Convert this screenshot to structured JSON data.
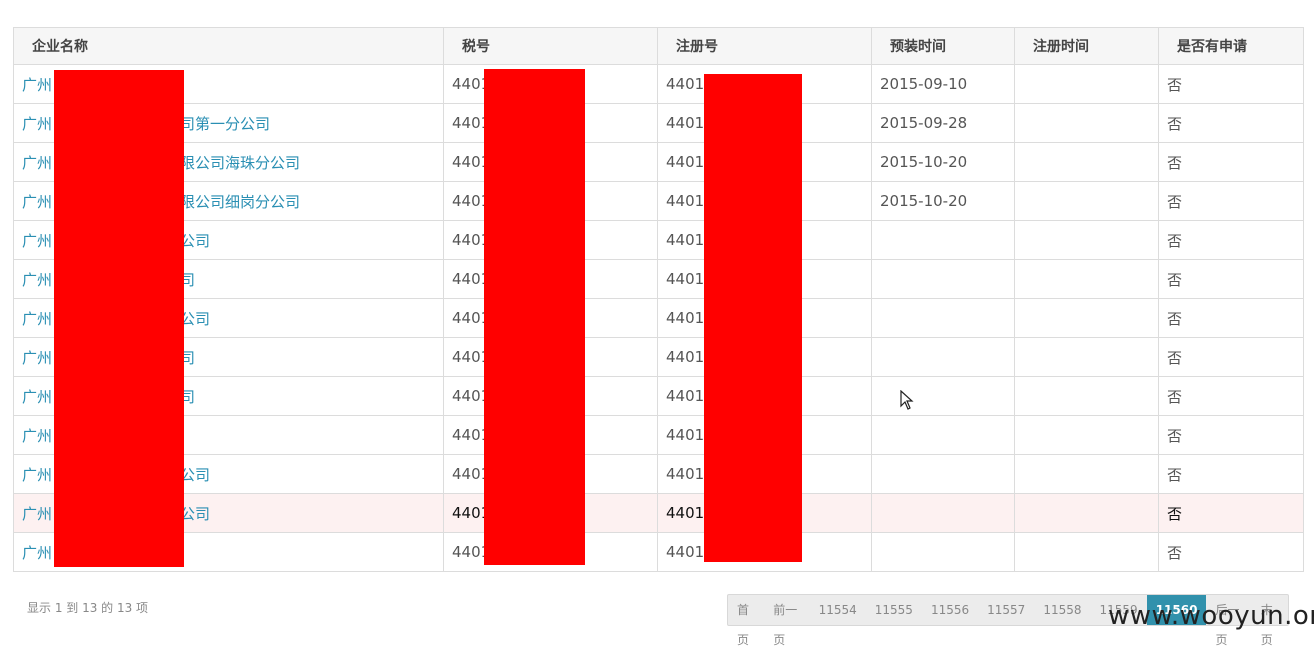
{
  "table": {
    "headers": [
      "企业名称",
      "税号",
      "注册号",
      "预装时间",
      "注册时间",
      "是否有申请"
    ],
    "rows": [
      {
        "name": "广州",
        "name_tail": "",
        "tax": "4401",
        "reg": "4401",
        "preinstall": "2015-09-10",
        "register": "",
        "applied": "否"
      },
      {
        "name": "广州",
        "name_tail": "司第一分公司",
        "tax": "4401",
        "reg": "4401",
        "preinstall": "2015-09-28",
        "register": "",
        "applied": "否"
      },
      {
        "name": "广州",
        "name_tail": "限公司海珠分公司",
        "tax": "4401",
        "reg": "4401",
        "preinstall": "2015-10-20",
        "register": "",
        "applied": "否"
      },
      {
        "name": "广州",
        "name_tail": "限公司细岗分公司",
        "tax": "4401",
        "reg": "4401",
        "preinstall": "2015-10-20",
        "register": "",
        "applied": "否"
      },
      {
        "name": "广州",
        "name_tail": "公司",
        "tax": "4401",
        "reg": "4401",
        "preinstall": "",
        "register": "",
        "applied": "否"
      },
      {
        "name": "广州",
        "name_tail": "司",
        "tax": "4401",
        "reg": "4401",
        "preinstall": "",
        "register": "",
        "applied": "否"
      },
      {
        "name": "广州",
        "name_tail": "公司",
        "tax": "4401",
        "reg": "4401",
        "preinstall": "",
        "register": "",
        "applied": "否"
      },
      {
        "name": "广州",
        "name_tail": "司",
        "tax": "4401",
        "reg": "4401",
        "preinstall": "",
        "register": "",
        "applied": "否"
      },
      {
        "name": "广州",
        "name_tail": "司",
        "tax": "4401",
        "reg": "4401",
        "preinstall": "",
        "register": "",
        "applied": "否"
      },
      {
        "name": "广州",
        "name_tail": "",
        "tax": "4401",
        "reg": "4401",
        "preinstall": "",
        "register": "",
        "applied": "否"
      },
      {
        "name": "广州",
        "name_tail": "公司",
        "tax": "4401",
        "reg": "4401",
        "preinstall": "",
        "register": "",
        "applied": "否"
      },
      {
        "name": "广州",
        "name_tail": "公司",
        "tax": "4401",
        "reg": "4401",
        "preinstall": "",
        "register": "",
        "applied": "否"
      },
      {
        "name": "广州",
        "name_tail": "",
        "tax": "4401",
        "reg": "4401",
        "preinstall": "",
        "register": "",
        "applied": "否"
      }
    ]
  },
  "footer": {
    "info": "显示 1 到 13 的 13 项"
  },
  "pagination": {
    "first": "首页",
    "prev": "前一页",
    "pages": [
      "11554",
      "11555",
      "11556",
      "11557",
      "11558",
      "11559",
      "11560"
    ],
    "active_page": "11560",
    "next": "后一页",
    "last": "末页"
  },
  "watermark": "www.wooyun.org",
  "colors": {
    "link": "#2a8fb3",
    "active_page": "#3191ac",
    "redaction": "#ff0000",
    "highlight_row": "#fdf1f1"
  }
}
